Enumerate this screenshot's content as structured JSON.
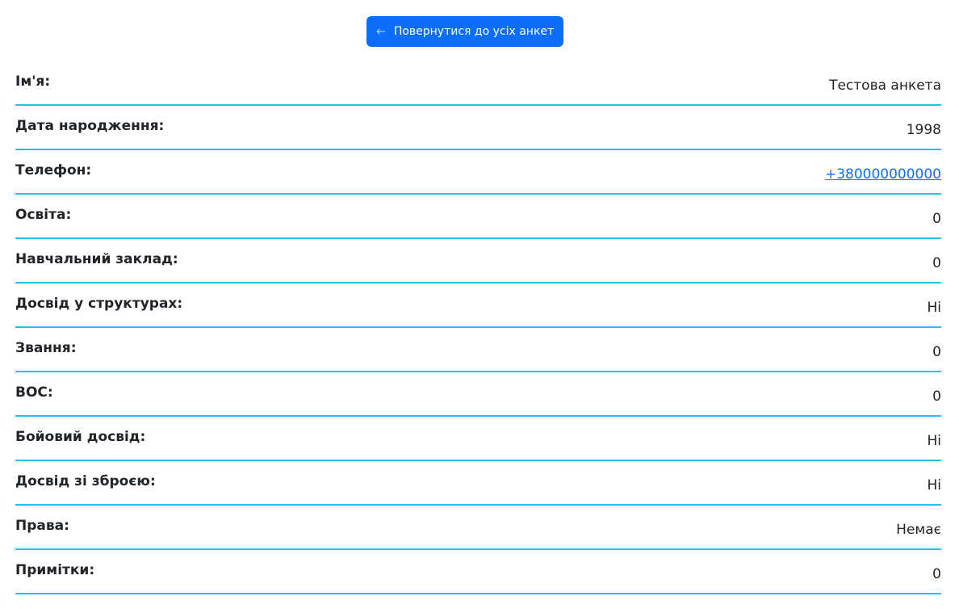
{
  "header": {
    "back_button_label": "Повернутися до усіх анкет",
    "back_icon": "arrow-left-icon"
  },
  "colors": {
    "accent": "#0d6efd",
    "divider": "#22c4e6",
    "text": "#212529"
  },
  "fields": [
    {
      "label": "Ім'я:",
      "value": "Тестова анкета"
    },
    {
      "label": "Дата народження:",
      "value": "1998"
    },
    {
      "label": "Телефон:",
      "value": "+380000000000"
    },
    {
      "label": "Освіта:",
      "value": "0"
    },
    {
      "label": "Навчальний заклад:",
      "value": "0"
    },
    {
      "label": "Досвід у структурах:",
      "value": "Ні"
    },
    {
      "label": "Звання:",
      "value": "0"
    },
    {
      "label": "ВОС:",
      "value": "0"
    },
    {
      "label": "Бойовий досвід:",
      "value": "Ні"
    },
    {
      "label": "Досвід зі зброєю:",
      "value": "Ні"
    },
    {
      "label": "Права:",
      "value": "Немає"
    },
    {
      "label": "Примітки:",
      "value": "0"
    }
  ]
}
